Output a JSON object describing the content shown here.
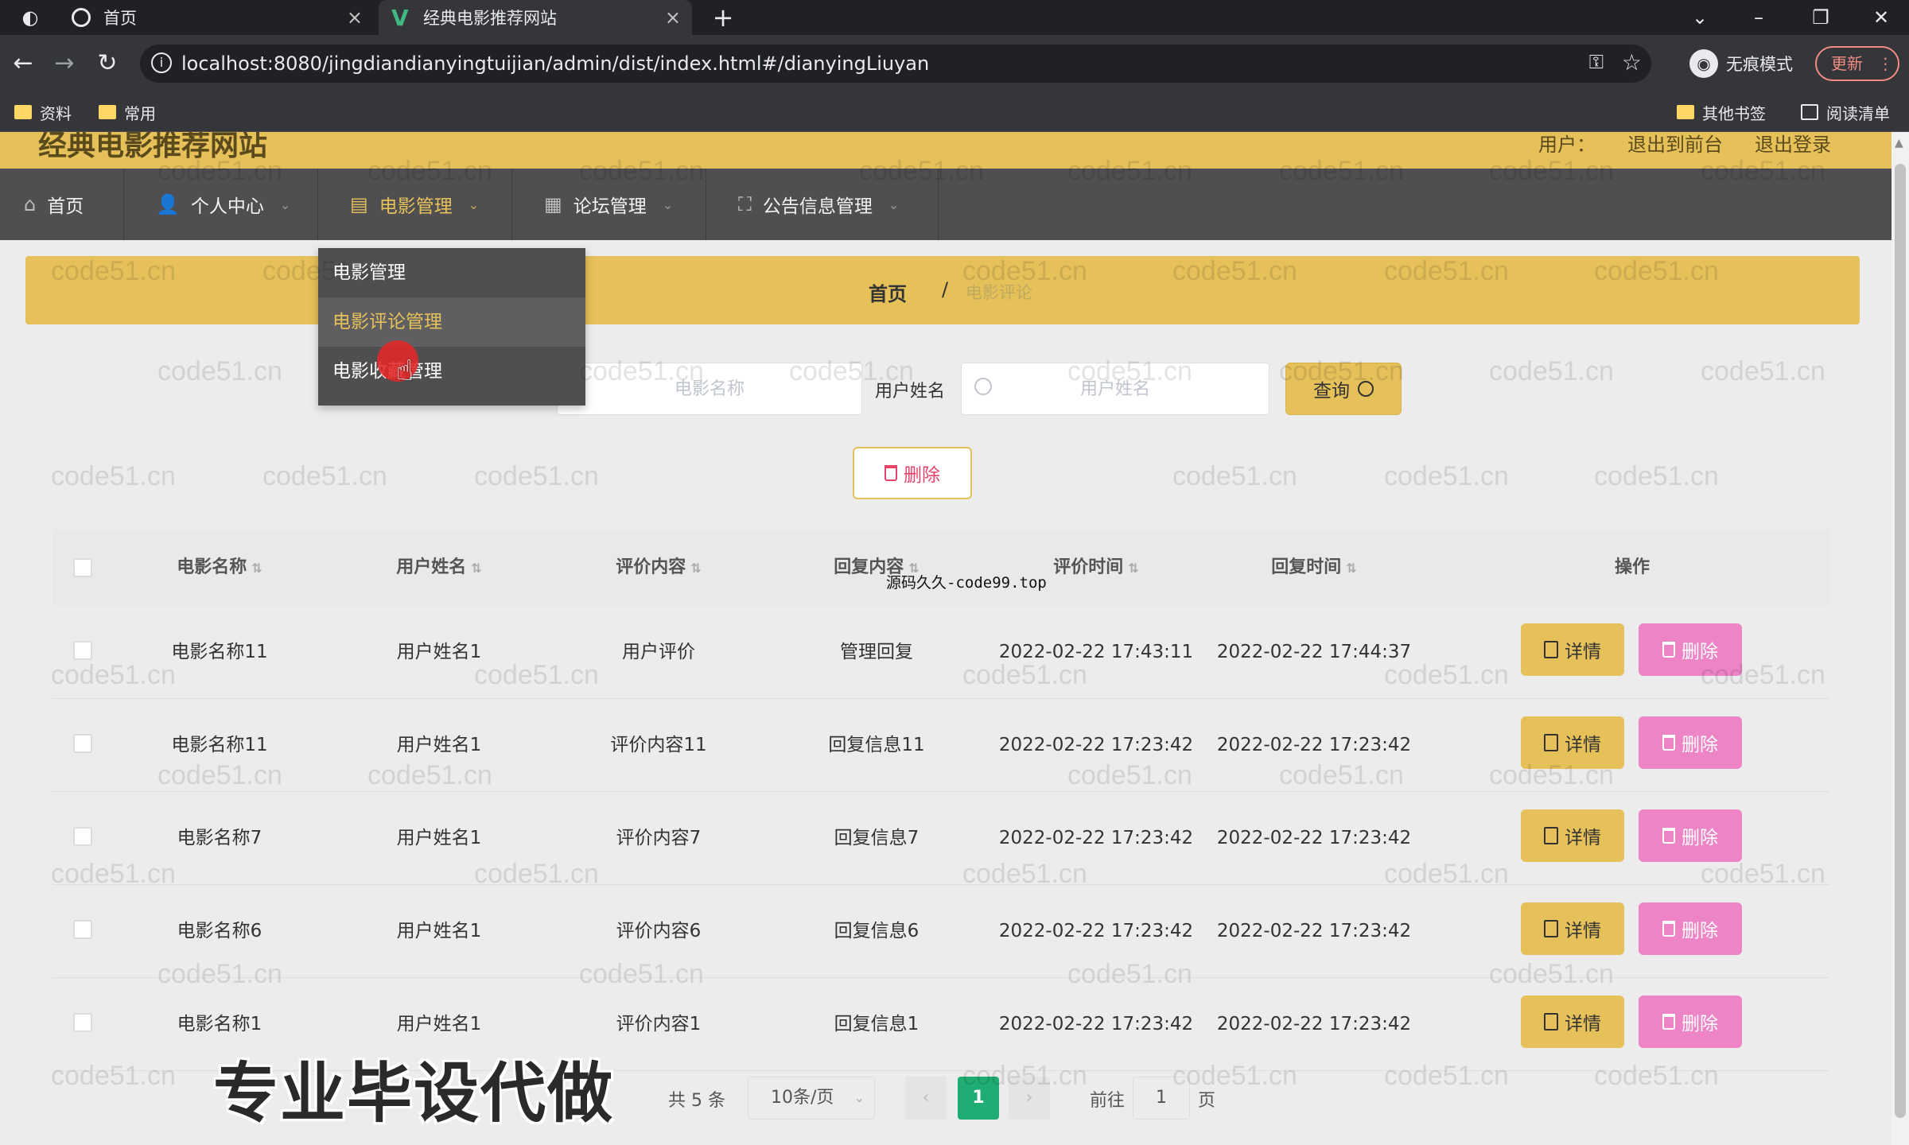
{
  "browser": {
    "tabs": [
      {
        "title": "首页"
      },
      {
        "title": "经典电影推荐网站"
      }
    ],
    "url": "localhost:8080/jingdiandianyingtuijian/admin/dist/index.html#/dianyingLiuyan",
    "incognito_label": "无痕模式",
    "update_label": "更新",
    "bookmarks": [
      "资料",
      "常用"
    ],
    "bookmarks_right": [
      "其他书签",
      "阅读清单"
    ]
  },
  "site": {
    "title": "经典电影推荐网站",
    "top_right": [
      "用户：",
      "退出到前台",
      "退出登录"
    ]
  },
  "menu": {
    "items": [
      {
        "label": "首页",
        "icon": "home-icon"
      },
      {
        "label": "个人中心",
        "icon": "user-icon"
      },
      {
        "label": "电影管理",
        "icon": "briefcase-icon"
      },
      {
        "label": "论坛管理",
        "icon": "document-icon"
      },
      {
        "label": "公告信息管理",
        "icon": "frame-icon"
      }
    ],
    "submenu": [
      "电影管理",
      "电影评论管理",
      "电影收藏管理"
    ]
  },
  "breadcrumb": {
    "home": "首页",
    "separator": "/",
    "current": "电影评论"
  },
  "search": {
    "movie_placeholder": "电影名称",
    "user_label": "用户姓名",
    "user_placeholder": "用户姓名",
    "query_label": "查询"
  },
  "actions": {
    "bulk_delete": "删除"
  },
  "table": {
    "columns": [
      "电影名称",
      "用户姓名",
      "评价内容",
      "回复内容",
      "评价时间",
      "回复时间",
      "操作"
    ],
    "detail_label": "详情",
    "delete_label": "删除",
    "rows": [
      {
        "movie": "电影名称11",
        "user": "用户姓名1",
        "review": "用户评价",
        "reply": "管理回复",
        "review_time": "2022-02-22 17:43:11",
        "reply_time": "2022-02-22 17:44:37"
      },
      {
        "movie": "电影名称11",
        "user": "用户姓名1",
        "review": "评价内容11",
        "reply": "回复信息11",
        "review_time": "2022-02-22 17:23:42",
        "reply_time": "2022-02-22 17:23:42"
      },
      {
        "movie": "电影名称7",
        "user": "用户姓名1",
        "review": "评价内容7",
        "reply": "回复信息7",
        "review_time": "2022-02-22 17:23:42",
        "reply_time": "2022-02-22 17:23:42"
      },
      {
        "movie": "电影名称6",
        "user": "用户姓名1",
        "review": "评价内容6",
        "reply": "回复信息6",
        "review_time": "2022-02-22 17:23:42",
        "reply_time": "2022-02-22 17:23:42"
      },
      {
        "movie": "电影名称1",
        "user": "用户姓名1",
        "review": "评价内容1",
        "reply": "回复信息1",
        "review_time": "2022-02-22 17:23:42",
        "reply_time": "2022-02-22 17:23:42"
      }
    ]
  },
  "pagination": {
    "total": "共 5 条",
    "page_size": "10条/页",
    "current_page": "1",
    "goto_label": "前往",
    "goto_value": "1",
    "page_suffix": "页"
  },
  "overlays": {
    "watermark_text": "code51.cn",
    "center_watermark": "源码久久-code99.top",
    "promo_text": "专业毕设代做"
  },
  "colors": {
    "accent_gold": "#e6c15a",
    "menu_bg": "#4f4f51",
    "delete_pink": "#ec84c6",
    "pager_active": "#1fad73"
  }
}
